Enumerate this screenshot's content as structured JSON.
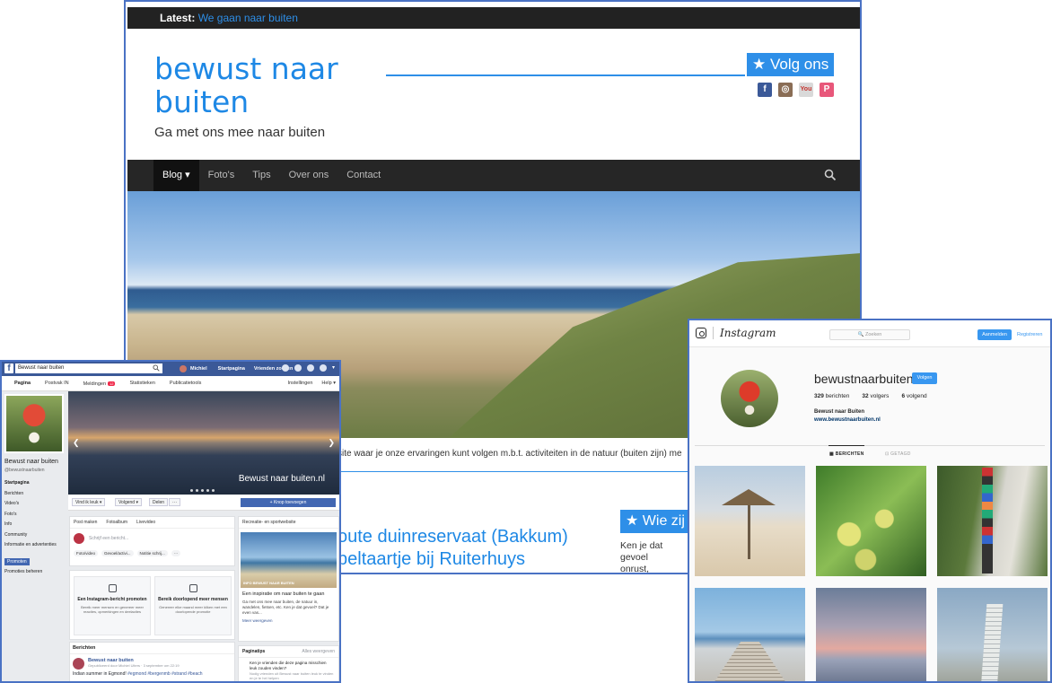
{
  "blog": {
    "latest_label": "Latest:",
    "latest_link": "We gaan naar buiten",
    "title_line1": "bewust naar",
    "title_line2": "buiten",
    "tagline": "Ga met ons mee naar buiten",
    "follow_label": "Volg ons",
    "nav": [
      "Blog ▾",
      "Foto's",
      "Tips",
      "Over ons",
      "Contact"
    ],
    "about_text": "site waar je onze ervaringen kunt volgen m.b.t. activiteiten in de natuur (buiten zijn) me",
    "post_title_line1": "oute duinreservaat (Bakkum)",
    "post_title_line2": "peltaartje bij Ruiterhuys",
    "wie_label": "Wie zij",
    "wie_text": "Ken je dat gevoel\nonrust, misschien\ngezellig voor je di"
  },
  "facebook": {
    "search_value": "Bewust naar buiten",
    "user_name": "Michiel",
    "top_links": [
      "Startpagina",
      "Vrienden zoeken"
    ],
    "tabs": [
      "Pagina",
      "Postvak IN",
      "Meldingen",
      "Statistieken",
      "Publicatietools"
    ],
    "notif_badge": "12",
    "tab_right": [
      "Instellingen",
      "Help ▾"
    ],
    "page_name": "Bewust naar buiten",
    "page_handle": "@bewustnaarbuiten",
    "side_nav": [
      "Startpagina",
      "Berichten",
      "Video's",
      "Foto's",
      "Info",
      "Community",
      "Informatie en advertenties"
    ],
    "promote_label": "Promoten",
    "promotions_label": "Promoties beheren",
    "cover_title": "Bewust naar buiten.nl",
    "actions": [
      "Vind ik leuk ▾",
      "Volgend ▾",
      "Delen",
      "···"
    ],
    "buy_label": "Knop toevoegen",
    "composer_tabs": [
      "Post maken",
      "Fotoalbum",
      "Livevideo"
    ],
    "composer_placeholder": "Schrijf een bericht...",
    "composer_buttons": [
      "Foto/video",
      "Gevoel/activi...",
      "Notitie schrij...",
      "···"
    ],
    "promo1_title": "Een Instagram-bericht promoten",
    "promo1_desc": "Bereik meer mensen en genereer meer reacties, opmerkingen en deelacties",
    "promo2_title": "Bereik doorlopend meer mensen",
    "promo2_desc": "Genereer elke maand meer kliken met een doorlopende promotie",
    "posts_header": "Berichten",
    "post_author": "Bewust naar buiten",
    "post_meta": "Gepubliceerd door Michiel Uiters · 3 september om 22:19",
    "post_text": "Indian summer in Egmond!",
    "post_tags": " #egmond #bergenmb #strand #beach",
    "rc_header": "Recreatie- en sportwebsite",
    "rc_caption": "INFO BEWUST NAAR BUITEN",
    "rc_title": "Een inspiratie om naar buiten te gaan",
    "rc_text": "Ga met ons mee naar buiten, de natuur in, wandelen, fietsen, etc. Ken je dat gevoel? Dat je even vas...",
    "rc_more": "Meer weergeven",
    "tips_header": "Paginatips",
    "tips_link": "Alles weergeven",
    "tips_text": "Ken je vrienden die deze pagina misschien leuk zouden vinden?",
    "tips_sub": "Nodig vrienden uit Bewust naar buiten leuk te vinden en je te hel helpen"
  },
  "instagram": {
    "logo": "Instagram",
    "search_placeholder": "🔍 Zoeken",
    "login_label": "Aanmelden",
    "register_label": "Registreren",
    "username": "bewustnaarbuiten",
    "follow_label": "Volgen",
    "posts_count": "329",
    "posts_label": "berichten",
    "followers_count": "32",
    "followers_label": "volgers",
    "following_count": "6",
    "following_label": "volgend",
    "bio_name": "Bewust naar Buiten",
    "bio_link": "www.bewustnaarbuiten.nl",
    "tab_posts": "▦ BERICHTEN",
    "tab_tagged": "⊡ GETAGD"
  },
  "colors": {
    "blog_blue": "#1e88e5",
    "fb_blue": "#3b5998",
    "ig_blue": "#3897f0",
    "frame": "#4a72c4"
  }
}
